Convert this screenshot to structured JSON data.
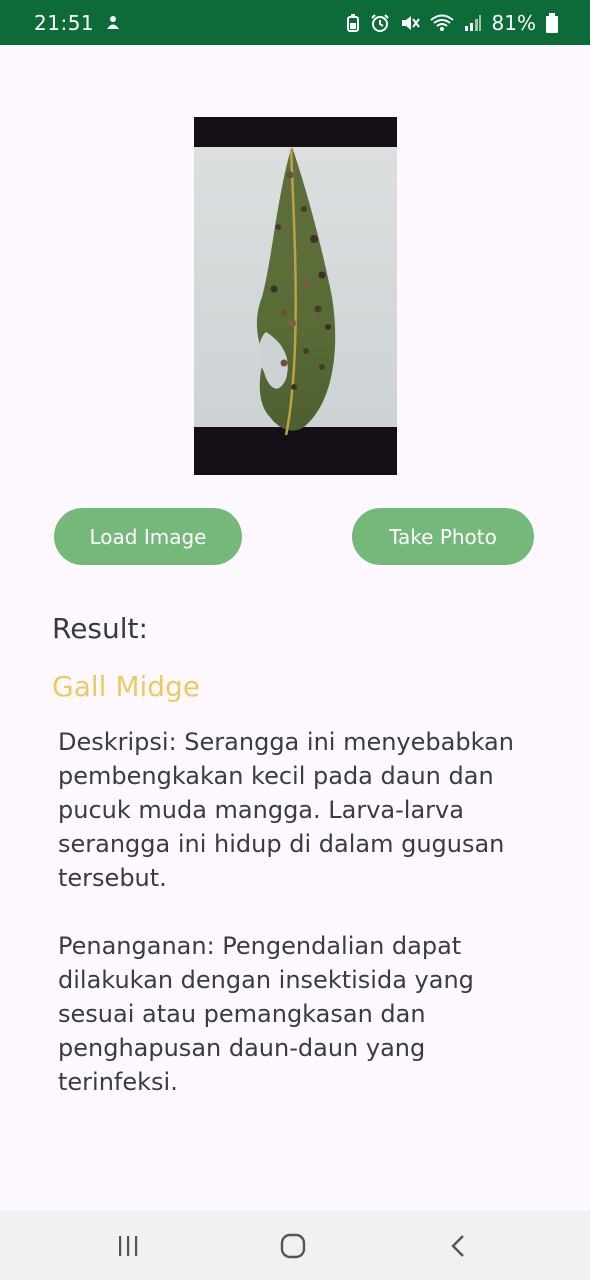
{
  "status_bar": {
    "time": "21:51",
    "battery": "81%"
  },
  "photo": {
    "alt": "Mango leaf with galls"
  },
  "buttons": {
    "load_image": "Load Image",
    "take_photo": "Take Photo"
  },
  "result": {
    "label": "Result:",
    "name": "Gall Midge",
    "description": "Deskripsi: Serangga ini menyebabkan pembengkakan kecil pada daun dan pucuk muda mangga. Larva-larva serangga ini hidup di dalam gugusan tersebut.",
    "treatment": "Penanganan: Pengendalian dapat dilakukan dengan insektisida yang sesuai atau pemangkasan dan penghapusan daun-daun yang terinfeksi."
  },
  "colors": {
    "status_bar": "#0c6b38",
    "button": "#74b87a",
    "result_name": "#e9cb64",
    "background": "#fdf8fd"
  }
}
